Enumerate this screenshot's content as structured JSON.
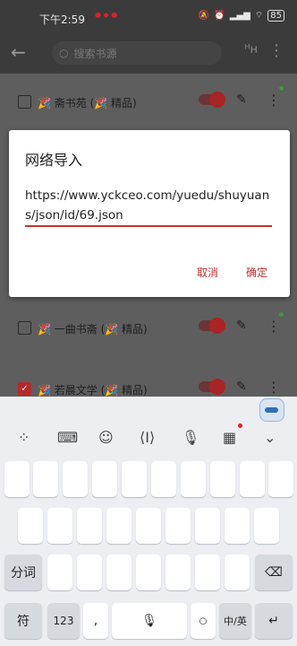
{
  "status_bar": {
    "time": "下午2:59",
    "battery": "85"
  },
  "app_bar": {
    "search_placeholder": "搜索书源",
    "group_label": "н"
  },
  "sources": [
    {
      "name": "🎉 斋书苑 (🎉 精品)",
      "checked": false
    },
    {
      "name": "🎉 一曲书斋 (🎉 精品)",
      "checked": false
    },
    {
      "name": "🎉 若晨文学 (🎉 精品)",
      "checked": true
    }
  ],
  "dialog": {
    "title": "网络导入",
    "url": "https://www.yckceo.com/yuedu/shuyuans/json/id/69.json",
    "cancel_label": "取消",
    "ok_label": "确定"
  },
  "keyboard": {
    "fenci_label": "分词",
    "symbol_label": "符",
    "num_label": "123",
    "comma_label": ",",
    "period_label": "○",
    "lang_label": "中/英"
  }
}
